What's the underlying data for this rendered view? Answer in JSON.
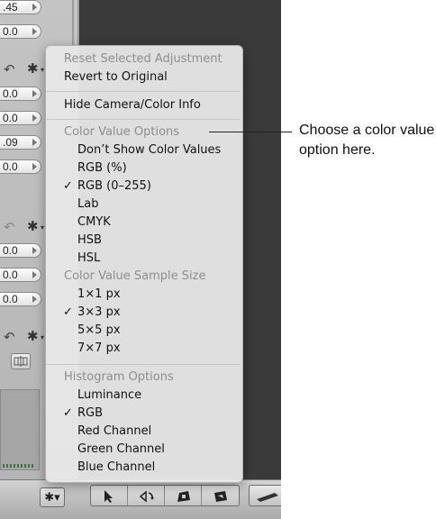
{
  "left_panel": {
    "fields": [
      ".45",
      "0.0",
      "0.0",
      "0.0",
      ".09",
      "0.0",
      "0.0",
      "0.0",
      "0.0"
    ],
    "icons": [
      "undo-icon",
      "gear-icon",
      "filmstrip-icon"
    ]
  },
  "menu": {
    "reset": "Reset Selected Adjustment",
    "revert": "Revert to Original",
    "hide_info": "Hide Camera/Color Info",
    "color_value_header": "Color Value Options",
    "color_value_options": [
      "Don’t Show Color Values",
      "RGB (%)",
      "RGB (0–255)",
      "Lab",
      "CMYK",
      "HSB",
      "HSL"
    ],
    "color_value_selected": "RGB (0–255)",
    "sample_size_header": "Color Value Sample Size",
    "sample_size_options": [
      "1×1 px",
      "3×3 px",
      "5×5 px",
      "7×7 px"
    ],
    "sample_size_selected": "3×3 px",
    "histogram_header": "Histogram Options",
    "histogram_options": [
      "Luminance",
      "RGB",
      "Red Channel",
      "Green Channel",
      "Blue Channel"
    ],
    "histogram_selected": "RGB",
    "checkmark": "✓"
  },
  "callout": {
    "text": "Choose a color value option here."
  },
  "toolbar": {
    "icons": [
      "gear-icon",
      "pointer-icon",
      "rotate-icon",
      "straighten-icon",
      "crop-icon",
      "lift-stamp-icon"
    ]
  }
}
